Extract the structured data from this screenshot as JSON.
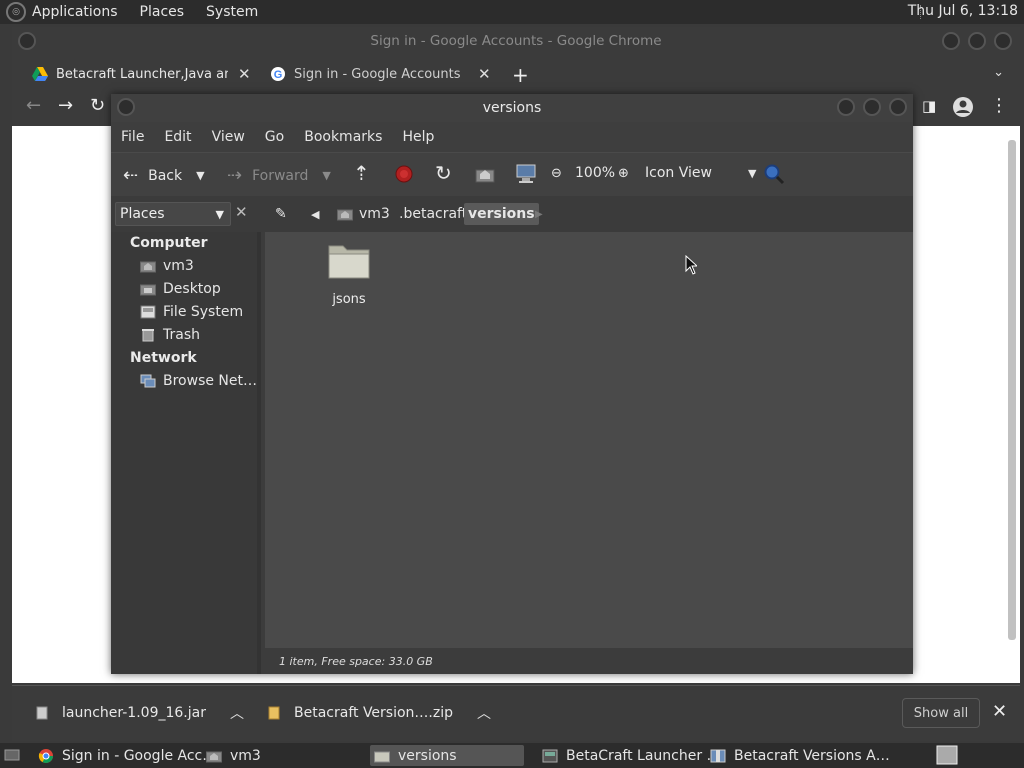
{
  "top_panel": {
    "menus": [
      "Applications",
      "Places",
      "System"
    ],
    "clock": "Thu Jul  6, 13:18"
  },
  "chrome": {
    "title": "Sign in - Google Accounts - Google Chrome",
    "tabs": [
      {
        "label": "Betacraft Launcher,Java and v"
      },
      {
        "label": "Sign in - Google Accounts"
      }
    ]
  },
  "file_manager": {
    "title": "versions",
    "menu": [
      "File",
      "Edit",
      "View",
      "Go",
      "Bookmarks",
      "Help"
    ],
    "toolbar": {
      "back": "Back",
      "forward": "Forward",
      "zoom": "100%",
      "view_mode": "Icon View"
    },
    "places_combo": "Places",
    "breadcrumbs": [
      "vm3",
      ".betacraft",
      "versions"
    ],
    "sidebar": {
      "computer_header": "Computer",
      "computer_items": [
        "vm3",
        "Desktop",
        "File System",
        "Trash"
      ],
      "network_header": "Network",
      "network_items": [
        "Browse Net…"
      ]
    },
    "items": [
      {
        "name": "jsons"
      }
    ],
    "status": "1 item, Free space: 33.0 GB"
  },
  "downloads": {
    "items": [
      {
        "name": "launcher-1.09_16.jar"
      },
      {
        "name": "Betacraft Version….zip"
      }
    ],
    "show_all": "Show all"
  },
  "taskbar": {
    "tasks": [
      {
        "label": "Sign in - Google Acc…"
      },
      {
        "label": "vm3"
      },
      {
        "label": "versions"
      },
      {
        "label": "BetaCraft Launcher …"
      },
      {
        "label": "Betacraft Versions A…"
      }
    ]
  }
}
